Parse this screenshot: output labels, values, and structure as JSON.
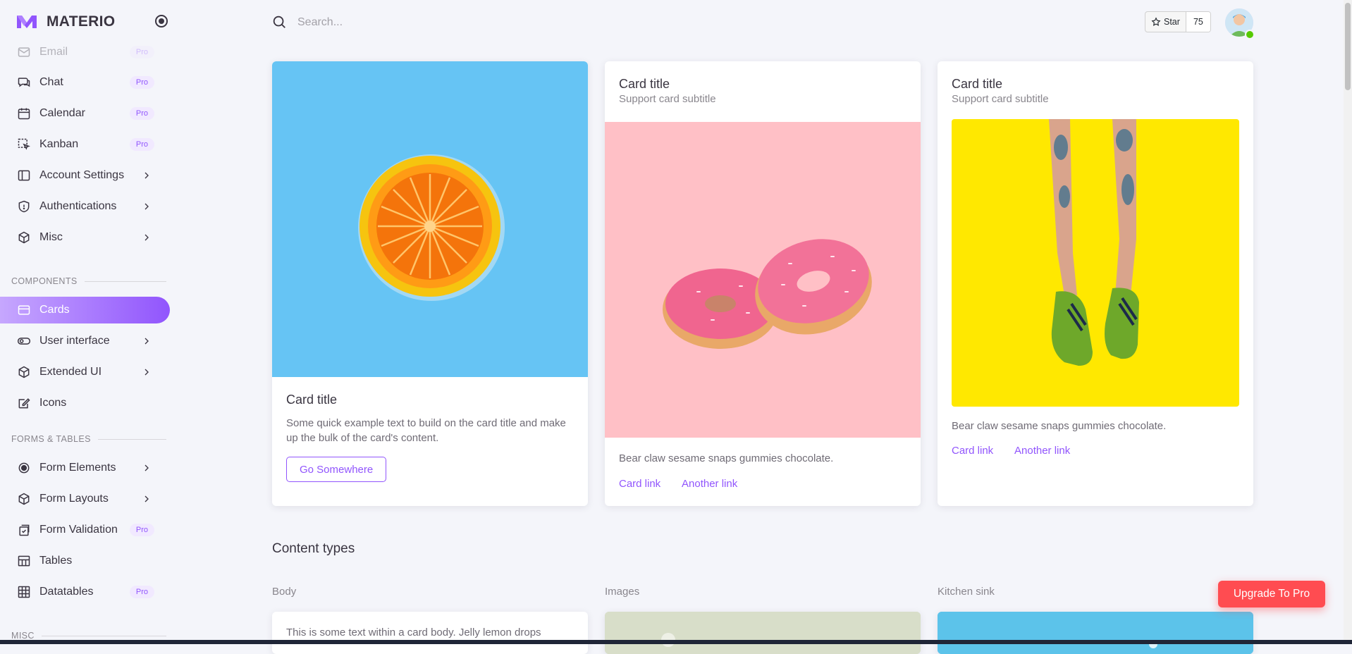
{
  "brand": {
    "name": "MATERIO"
  },
  "search": {
    "placeholder": "Search..."
  },
  "github": {
    "star_label": "Star",
    "star_count": "75"
  },
  "sidebar": {
    "items": [
      {
        "label": "Email",
        "pro": "Pro"
      },
      {
        "label": "Chat",
        "pro": "Pro"
      },
      {
        "label": "Calendar",
        "pro": "Pro"
      },
      {
        "label": "Kanban",
        "pro": "Pro"
      },
      {
        "label": "Account Settings"
      },
      {
        "label": "Authentications"
      },
      {
        "label": "Misc"
      },
      {
        "label": "Cards"
      },
      {
        "label": "User interface"
      },
      {
        "label": "Extended UI"
      },
      {
        "label": "Icons"
      },
      {
        "label": "Form Elements"
      },
      {
        "label": "Form Layouts"
      },
      {
        "label": "Form Validation",
        "pro": "Pro"
      },
      {
        "label": "Tables"
      },
      {
        "label": "Datatables",
        "pro": "Pro"
      }
    ],
    "sections": {
      "components": "COMPONENTS",
      "forms_tables": "FORMS & TABLES",
      "misc": "MISC"
    }
  },
  "cards": [
    {
      "title": "Card title",
      "text": "Some quick example text to build on the card title and make up the bulk of the card's content.",
      "button": "Go Somewhere"
    },
    {
      "title": "Card title",
      "subtitle": "Support card subtitle",
      "text": "Bear claw sesame snaps gummies chocolate.",
      "link1": "Card link",
      "link2": "Another link"
    },
    {
      "title": "Card title",
      "subtitle": "Support card subtitle",
      "text": "Bear claw sesame snaps gummies chocolate.",
      "link1": "Card link",
      "link2": "Another link"
    }
  ],
  "content_types": {
    "title": "Content types",
    "body_label": "Body",
    "images_label": "Images",
    "kitchen_label": "Kitchen sink",
    "body_text": "This is some text within a card body. Jelly lemon drops"
  },
  "upgrade": {
    "label": "Upgrade To Pro"
  },
  "colors": {
    "primary": "#9155fd",
    "upgrade": "#ff4c51",
    "background": "#f4f5fa"
  }
}
